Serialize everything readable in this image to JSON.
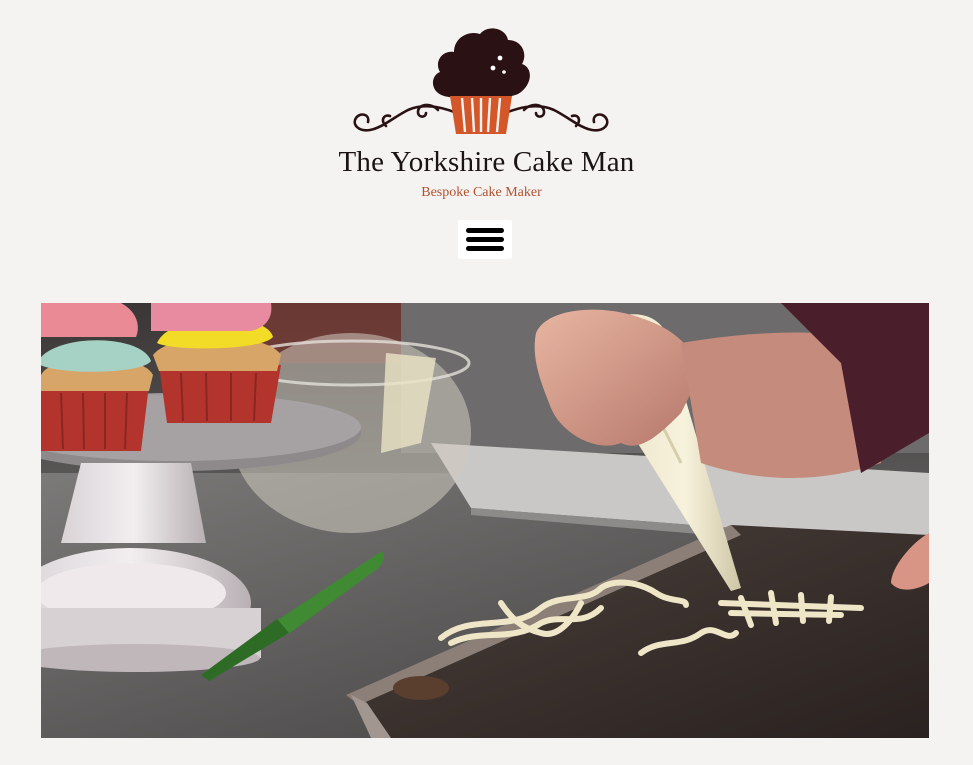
{
  "site": {
    "title": "The Yorkshire Cake Man",
    "tagline": "Bespoke Cake Maker"
  },
  "logo": {
    "icon": "cupcake-logo-icon",
    "colors": {
      "frosting": "#2a1214",
      "case": "#d4572a",
      "swirl": "#2a1214"
    }
  },
  "nav": {
    "menu_icon": "hamburger-menu-icon"
  },
  "hero": {
    "image_subject": "baking-photo"
  }
}
